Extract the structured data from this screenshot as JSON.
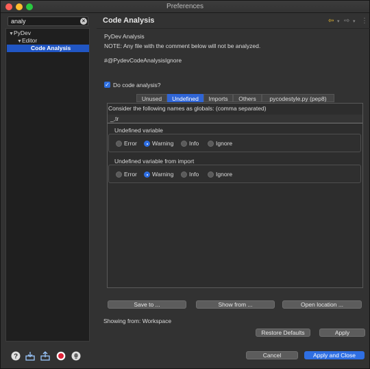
{
  "window": {
    "title": "Preferences"
  },
  "sidebar": {
    "filter_value": "analy",
    "tree": [
      {
        "label": "PyDev",
        "expanded": true
      },
      {
        "label": "Editor",
        "expanded": true
      },
      {
        "label": "Code Analysis",
        "selected": true
      }
    ]
  },
  "bottom_icons": [
    "help-icon",
    "import-icon",
    "export-icon",
    "record-icon",
    "lightbulb-icon"
  ],
  "page": {
    "title": "Code Analysis",
    "section": "PyDev Analysis",
    "note": "NOTE: Any file with the comment below will not be analyzed.",
    "ignore_comment": "#@PydevCodeAnalysisIgnore",
    "do_analysis_label": "Do code analysis?",
    "do_analysis_checked": true,
    "tabs": [
      "Unused",
      "Undefined",
      "Imports",
      "Others",
      "pycodestyle.py (pep8)"
    ],
    "active_tab": "Undefined",
    "globals_label": "Consider the following names as globals: (comma separated)",
    "globals_value": "_,tr",
    "groups": [
      {
        "title": "Undefined variable",
        "options": [
          "Error",
          "Warning",
          "Info",
          "Ignore"
        ],
        "selected": "Warning"
      },
      {
        "title": "Undefined variable from import",
        "options": [
          "Error",
          "Warning",
          "Info",
          "Ignore"
        ],
        "selected": "Warning"
      }
    ],
    "buttons": {
      "save_to": "Save to ...",
      "show_from": "Show from ...",
      "open_location": "Open location ...",
      "restore_defaults": "Restore Defaults",
      "apply": "Apply",
      "cancel": "Cancel",
      "apply_and_close": "Apply and Close"
    },
    "showing_from": "Showing from: Workspace"
  },
  "colors": {
    "accent": "#2f6fe3",
    "background": "#323232",
    "selection": "#2156c4"
  }
}
